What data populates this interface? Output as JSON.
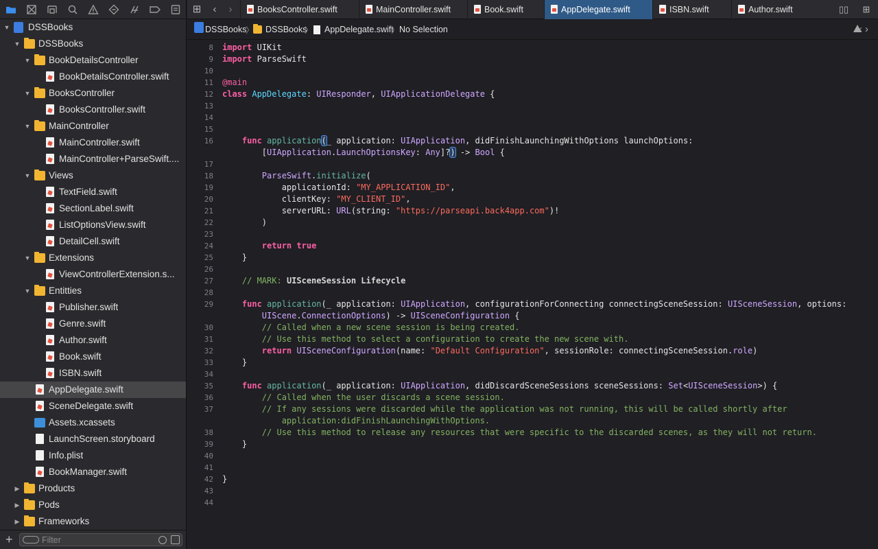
{
  "nav_toolbar": {
    "icons": [
      "folder-icon",
      "source-control-icon",
      "symbol-icon",
      "find-icon",
      "issue-icon",
      "test-icon",
      "debug-icon",
      "breakpoint-icon",
      "report-icon"
    ]
  },
  "tree": [
    {
      "label": "DSSBooks",
      "kind": "project",
      "depth": 0,
      "disclosure": "open"
    },
    {
      "label": "DSSBooks",
      "kind": "folder",
      "depth": 1,
      "disclosure": "open"
    },
    {
      "label": "BookDetailsController",
      "kind": "folder",
      "depth": 2,
      "disclosure": "open"
    },
    {
      "label": "BookDetailsController.swift",
      "kind": "swift",
      "depth": 3
    },
    {
      "label": "BooksController",
      "kind": "folder",
      "depth": 2,
      "disclosure": "open"
    },
    {
      "label": "BooksController.swift",
      "kind": "swift",
      "depth": 3
    },
    {
      "label": "MainController",
      "kind": "folder",
      "depth": 2,
      "disclosure": "open"
    },
    {
      "label": "MainController.swift",
      "kind": "swift",
      "depth": 3
    },
    {
      "label": "MainController+ParseSwift....",
      "kind": "swift",
      "depth": 3
    },
    {
      "label": "Views",
      "kind": "folder",
      "depth": 2,
      "disclosure": "open"
    },
    {
      "label": "TextField.swift",
      "kind": "swift",
      "depth": 3
    },
    {
      "label": "SectionLabel.swift",
      "kind": "swift",
      "depth": 3
    },
    {
      "label": "ListOptionsView.swift",
      "kind": "swift",
      "depth": 3
    },
    {
      "label": "DetailCell.swift",
      "kind": "swift",
      "depth": 3
    },
    {
      "label": "Extensions",
      "kind": "folder",
      "depth": 2,
      "disclosure": "open"
    },
    {
      "label": "ViewControllerExtension.s...",
      "kind": "swift",
      "depth": 3
    },
    {
      "label": "Entitties",
      "kind": "folder",
      "depth": 2,
      "disclosure": "open"
    },
    {
      "label": "Publisher.swift",
      "kind": "swift",
      "depth": 3
    },
    {
      "label": "Genre.swift",
      "kind": "swift",
      "depth": 3
    },
    {
      "label": "Author.swift",
      "kind": "swift",
      "depth": 3
    },
    {
      "label": "Book.swift",
      "kind": "swift",
      "depth": 3
    },
    {
      "label": "ISBN.swift",
      "kind": "swift",
      "depth": 3
    },
    {
      "label": "AppDelegate.swift",
      "kind": "swift",
      "depth": 2,
      "selected": true
    },
    {
      "label": "SceneDelegate.swift",
      "kind": "swift",
      "depth": 2
    },
    {
      "label": "Assets.xcassets",
      "kind": "assets",
      "depth": 2
    },
    {
      "label": "LaunchScreen.storyboard",
      "kind": "file",
      "depth": 2
    },
    {
      "label": "Info.plist",
      "kind": "file",
      "depth": 2
    },
    {
      "label": "BookManager.swift",
      "kind": "swift",
      "depth": 2
    },
    {
      "label": "Products",
      "kind": "folder",
      "depth": 1,
      "disclosure": "closed"
    },
    {
      "label": "Pods",
      "kind": "folder",
      "depth": 1,
      "disclosure": "closed"
    },
    {
      "label": "Frameworks",
      "kind": "folder",
      "depth": 1,
      "disclosure": "closed"
    }
  ],
  "filter": {
    "placeholder": "Filter",
    "value": ""
  },
  "tabs": [
    {
      "label": "BooksController.swift",
      "active": false
    },
    {
      "label": "MainController.swift",
      "active": false
    },
    {
      "label": "Book.swift",
      "active": false
    },
    {
      "label": "AppDelegate.swift",
      "active": true
    },
    {
      "label": "ISBN.swift",
      "active": false
    },
    {
      "label": "Author.swift",
      "active": false
    }
  ],
  "jumpbar": {
    "project": "DSSBooks",
    "group": "DSSBooks",
    "file": "AppDelegate.swift",
    "selection": "No Selection"
  },
  "code_lines": [
    {
      "n": "8",
      "t": [
        [
          "kw",
          "import"
        ],
        [
          "",
          "UIKit"
        ]
      ]
    },
    {
      "n": "9",
      "t": [
        [
          "kw",
          "import"
        ],
        [
          "",
          "ParseSwift"
        ]
      ]
    },
    {
      "n": "10",
      "t": []
    },
    {
      "n": "11",
      "t": [
        [
          "at",
          "@main"
        ]
      ]
    },
    {
      "n": "12",
      "t": [
        [
          "kw",
          "class"
        ],
        [
          "",
          " "
        ],
        [
          "tyd",
          "AppDelegate"
        ],
        [
          "",
          ": "
        ],
        [
          "ty",
          "UIResponder"
        ],
        [
          "",
          ", "
        ],
        [
          "ty",
          "UIApplicationDelegate"
        ],
        [
          "",
          " {"
        ]
      ]
    },
    {
      "n": "13",
      "t": []
    },
    {
      "n": "14",
      "t": []
    },
    {
      "n": "15",
      "t": []
    },
    {
      "n": "16",
      "t": [
        [
          "",
          "    "
        ],
        [
          "kw",
          "func"
        ],
        [
          "",
          " "
        ],
        [
          "fn",
          "application"
        ],
        [
          "hl",
          "("
        ],
        [
          "",
          "_ application: "
        ],
        [
          "ty",
          "UIApplication"
        ],
        [
          "",
          ", didFinishLaunchingWithOptions launchOptions:"
        ]
      ]
    },
    {
      "n": "",
      "t": [
        [
          "",
          "        ["
        ],
        [
          "ty",
          "UIApplication"
        ],
        [
          "",
          "."
        ],
        [
          "ty",
          "LaunchOptionsKey"
        ],
        [
          "",
          ": "
        ],
        [
          "ty",
          "Any"
        ],
        [
          "",
          "]?"
        ],
        [
          "hl",
          ")"
        ],
        [
          "",
          " -> "
        ],
        [
          "ty",
          "Bool"
        ],
        [
          "",
          " {"
        ]
      ]
    },
    {
      "n": "17",
      "t": []
    },
    {
      "n": "18",
      "t": [
        [
          "",
          "        "
        ],
        [
          "ty",
          "ParseSwift"
        ],
        [
          "",
          "."
        ],
        [
          "fn",
          "initialize"
        ],
        [
          "",
          "("
        ]
      ]
    },
    {
      "n": "19",
      "t": [
        [
          "",
          "            applicationId: "
        ],
        [
          "str",
          "\"MY_APPLICATION_ID\""
        ],
        [
          "",
          ","
        ]
      ]
    },
    {
      "n": "20",
      "t": [
        [
          "",
          "            clientKey: "
        ],
        [
          "str",
          "\"MY_CLIENT_ID\""
        ],
        [
          "",
          ","
        ]
      ]
    },
    {
      "n": "21",
      "t": [
        [
          "",
          "            serverURL: "
        ],
        [
          "ty",
          "URL"
        ],
        [
          "",
          "(string: "
        ],
        [
          "str",
          "\"https://parseapi.back4app.com\""
        ],
        [
          "",
          ")!"
        ]
      ]
    },
    {
      "n": "22",
      "t": [
        [
          "",
          "        )"
        ]
      ]
    },
    {
      "n": "23",
      "t": []
    },
    {
      "n": "24",
      "t": [
        [
          "",
          "        "
        ],
        [
          "kw",
          "return"
        ],
        [
          "",
          " "
        ],
        [
          "kw",
          "true"
        ]
      ]
    },
    {
      "n": "25",
      "t": [
        [
          "",
          "    }"
        ]
      ]
    },
    {
      "n": "26",
      "t": []
    },
    {
      "n": "27",
      "t": [
        [
          "",
          "    "
        ],
        [
          "cm",
          "// MARK: "
        ],
        [
          "cmb",
          "UISceneSession Lifecycle"
        ]
      ]
    },
    {
      "n": "28",
      "t": []
    },
    {
      "n": "29",
      "t": [
        [
          "",
          "    "
        ],
        [
          "kw",
          "func"
        ],
        [
          "",
          " "
        ],
        [
          "fn",
          "application"
        ],
        [
          "",
          "(_ application: "
        ],
        [
          "ty",
          "UIApplication"
        ],
        [
          "",
          ", configurationForConnecting connectingSceneSession: "
        ],
        [
          "ty",
          "UISceneSession"
        ],
        [
          "",
          ", options:"
        ]
      ]
    },
    {
      "n": "",
      "t": [
        [
          "",
          "        "
        ],
        [
          "ty",
          "UIScene"
        ],
        [
          "",
          "."
        ],
        [
          "ty",
          "ConnectionOptions"
        ],
        [
          "",
          ") -> "
        ],
        [
          "ty",
          "UISceneConfiguration"
        ],
        [
          "",
          " {"
        ]
      ]
    },
    {
      "n": "30",
      "t": [
        [
          "",
          "        "
        ],
        [
          "cm",
          "// Called when a new scene session is being created."
        ]
      ]
    },
    {
      "n": "31",
      "t": [
        [
          "",
          "        "
        ],
        [
          "cm",
          "// Use this method to select a configuration to create the new scene with."
        ]
      ]
    },
    {
      "n": "32",
      "t": [
        [
          "",
          "        "
        ],
        [
          "kw",
          "return"
        ],
        [
          "",
          " "
        ],
        [
          "ty",
          "UISceneConfiguration"
        ],
        [
          "",
          "(name: "
        ],
        [
          "str",
          "\"Default Configuration\""
        ],
        [
          "",
          ", sessionRole: connectingSceneSession."
        ],
        [
          "ty",
          "role"
        ],
        [
          "",
          ")"
        ]
      ]
    },
    {
      "n": "33",
      "t": [
        [
          "",
          "    }"
        ]
      ]
    },
    {
      "n": "34",
      "t": []
    },
    {
      "n": "35",
      "t": [
        [
          "",
          "    "
        ],
        [
          "kw",
          "func"
        ],
        [
          "",
          " "
        ],
        [
          "fn",
          "application"
        ],
        [
          "",
          "(_ application: "
        ],
        [
          "ty",
          "UIApplication"
        ],
        [
          "",
          ", didDiscardSceneSessions sceneSessions: "
        ],
        [
          "ty",
          "Set"
        ],
        [
          "",
          "<"
        ],
        [
          "ty",
          "UISceneSession"
        ],
        [
          "",
          ">) {"
        ]
      ]
    },
    {
      "n": "36",
      "t": [
        [
          "",
          "        "
        ],
        [
          "cm",
          "// Called when the user discards a scene session."
        ]
      ]
    },
    {
      "n": "37",
      "t": [
        [
          "",
          "        "
        ],
        [
          "cm",
          "// If any sessions were discarded while the application was not running, this will be called shortly after"
        ]
      ]
    },
    {
      "n": "",
      "t": [
        [
          "",
          "            "
        ],
        [
          "cm",
          "application:didFinishLaunchingWithOptions."
        ]
      ]
    },
    {
      "n": "38",
      "t": [
        [
          "",
          "        "
        ],
        [
          "cm",
          "// Use this method to release any resources that were specific to the discarded scenes, as they will not return."
        ]
      ]
    },
    {
      "n": "39",
      "t": [
        [
          "",
          "    }"
        ]
      ]
    },
    {
      "n": "40",
      "t": []
    },
    {
      "n": "41",
      "t": []
    },
    {
      "n": "42",
      "t": [
        [
          "",
          "}"
        ]
      ]
    },
    {
      "n": "43",
      "t": []
    },
    {
      "n": "44",
      "t": []
    }
  ],
  "colors": {
    "background": "#1f1f24",
    "sidebar": "#2a2a2e",
    "selection": "#464649",
    "active_tab": "#2f5a87",
    "keyword": "#fc5fa3",
    "string": "#fc6a5d",
    "comment": "#84b360"
  }
}
